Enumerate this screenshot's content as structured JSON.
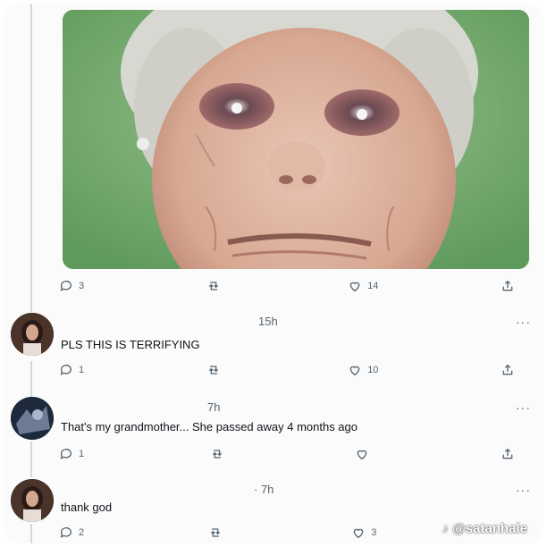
{
  "photo": {
    "alt_subject": "elderly woman close-up"
  },
  "post_actions": {
    "replies": "3",
    "retweets": "",
    "likes": "14"
  },
  "replies": [
    {
      "time": "15h",
      "text": "PLS THIS IS TERRIFYING",
      "more": "···",
      "actions": {
        "replies": "1",
        "retweets": "",
        "likes": "10"
      }
    },
    {
      "time": "7h",
      "text": "That's my grandmother... She passed away 4 months ago",
      "more": "···",
      "actions": {
        "replies": "1",
        "retweets": "",
        "likes": ""
      }
    },
    {
      "time": "· 7h",
      "text": "thank god",
      "more": "···",
      "actions": {
        "replies": "2",
        "retweets": "",
        "likes": "3"
      }
    }
  ],
  "watermark": "♪ @satanhale",
  "colors": {
    "icon": "#536471",
    "thread_line": "#cfd9de"
  }
}
